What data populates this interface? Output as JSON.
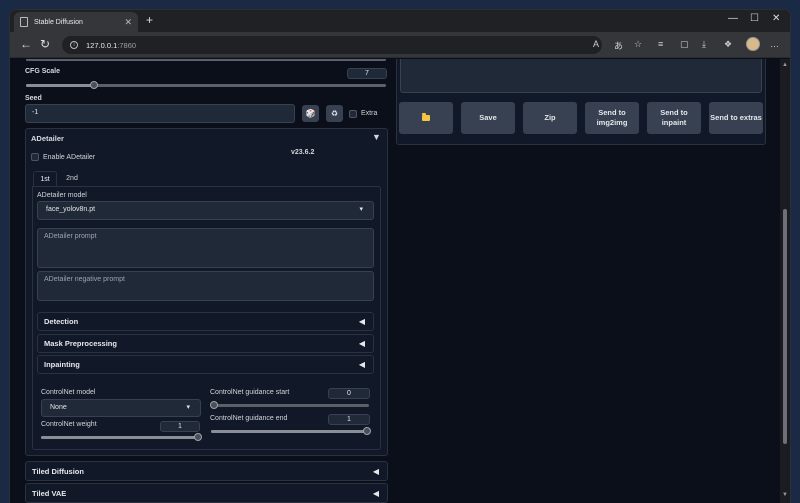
{
  "browser": {
    "tab_title": "Stable Diffusion",
    "url_host": "127.0.0.1",
    "url_port": ":7860"
  },
  "cfg": {
    "label": "CFG Scale",
    "value": "7",
    "fraction": 0.19
  },
  "seed": {
    "label": "Seed",
    "value": "-1",
    "extra_label": "Extra"
  },
  "adetailer": {
    "title": "ADetailer",
    "enable_label": "Enable ADetailer",
    "version": "v23.6.2",
    "tabs": [
      "1st",
      "2nd"
    ],
    "model_label": "ADetailer model",
    "model_value": "face_yolov8n.pt",
    "prompt_placeholder": "ADetailer prompt",
    "negative_prompt_placeholder": "ADetailer negative prompt",
    "sections": [
      "Detection",
      "Mask Preprocessing",
      "Inpainting"
    ],
    "controlnet": {
      "model_label": "ControlNet model",
      "model_value": "None",
      "weight_label": "ControlNet weight",
      "weight_value": "1",
      "guidance_start_label": "ControlNet guidance start",
      "guidance_start_value": "0",
      "guidance_end_label": "ControlNet guidance end",
      "guidance_end_value": "1"
    }
  },
  "extensions": [
    "Tiled Diffusion",
    "Tiled VAE"
  ],
  "actions": [
    {
      "label": "",
      "icon": "folder-icon"
    },
    {
      "label": "Save"
    },
    {
      "label": "Zip"
    },
    {
      "label": "Send to img2img"
    },
    {
      "label": "Send to inpaint"
    },
    {
      "label": "Send to extras"
    }
  ],
  "colors": {
    "background": "#0b0f19",
    "panel": "#111827",
    "button": "#374151",
    "folder": "#f5c443"
  }
}
